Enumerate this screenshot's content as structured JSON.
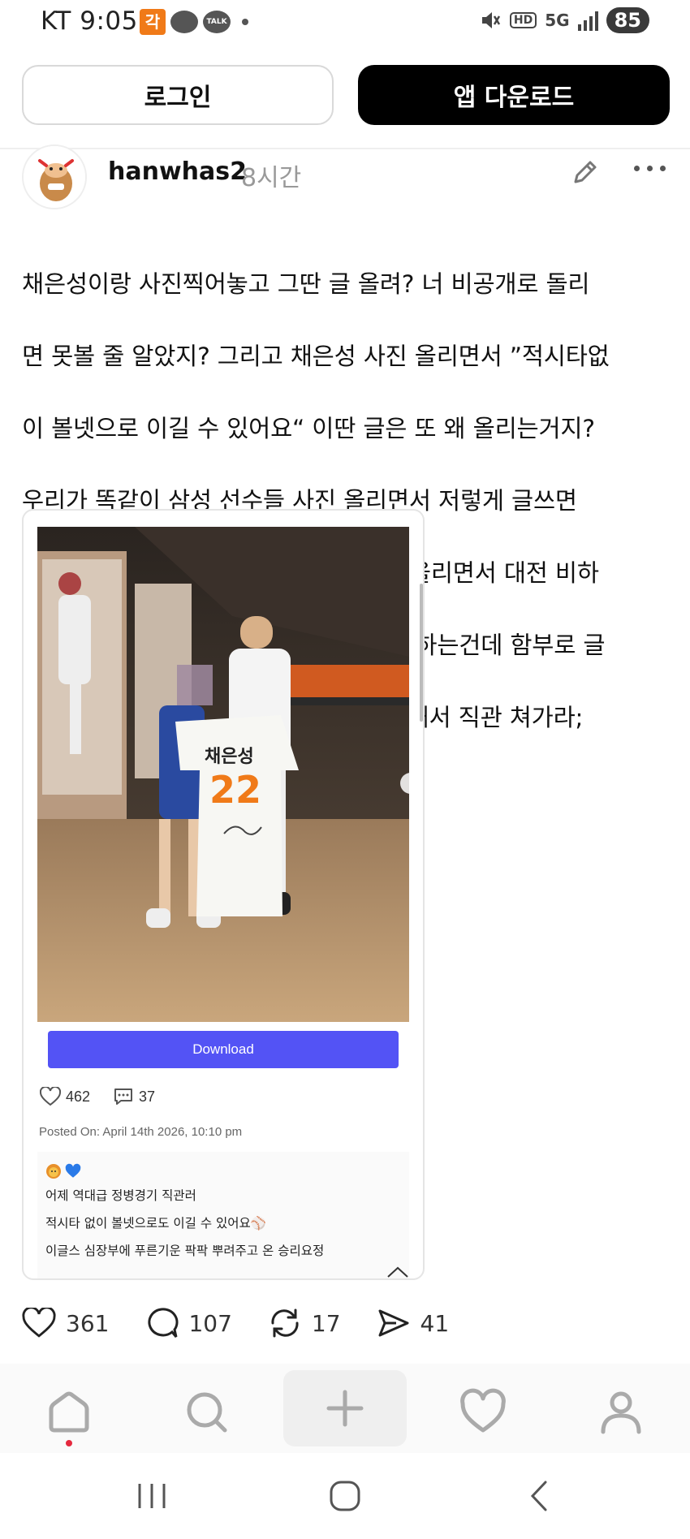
{
  "status_bar": {
    "carrier": "KT",
    "time": "9:05",
    "network": "5G",
    "battery": "85",
    "hd_label": "HD",
    "talk_label": "TALK",
    "kt_badge": "각"
  },
  "top_buttons": {
    "login_label": "로그인",
    "app_download_label": "앱 다운로드"
  },
  "post": {
    "username": "hanwhas2",
    "time_ago": "8시간",
    "lines": [
      "채은성이랑 사진찍어놓고 그딴 글 올려? 너 비공개로 돌리",
      "면 못볼 줄 알았지? 그리고 채은성 사진 올리면서 ”적시타없",
      "이 볼넷으로 이길 수 있어요“ 이딴 글은 또 왜 올리는거지?",
      "우리가 똑같이 삼성 선수들 사진 올리면서 저렇게 글쓰면",
      "누구보다 발작할 사람이 우리 주장 사진올리면서 대전 비하",
      "에, 구단 비하를 해...? 너 누구덕에 직관하는건데 함부로 글",
      "을 쓰는거야? 그럴거면 너가 직접 표 구해서 직관 쳐가라;"
    ],
    "stats": {
      "likes": "361",
      "comments": "107",
      "reposts": "17",
      "shares": "41"
    }
  },
  "embed": {
    "jersey_name": "채은성",
    "jersey_number": "22",
    "download_label": "Download",
    "likes": "462",
    "comments": "37",
    "posted_on": "Posted On: April 14th 2026, 10:10 pm",
    "caption_lines": [
      "어제 역대급 정병경기 직관러",
      "적시타 없이 볼넷으로도 이길 수 있어요⚾",
      "이글스 심장부에 푸른기운 팍팍 뿌려주고 온 승리요정"
    ]
  },
  "bottom_nav": {
    "items": [
      "home-icon",
      "search-icon",
      "plus-icon",
      "heart-icon",
      "profile-icon"
    ]
  },
  "colors": {
    "download_button": "#5353f5",
    "notification_dot": "#e5293e",
    "app_button": "#000000",
    "jersey_number": "#f07a18"
  }
}
